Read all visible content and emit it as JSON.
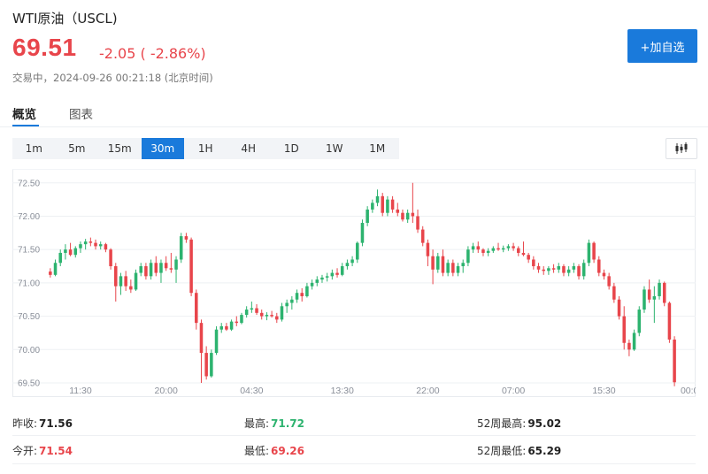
{
  "header": {
    "title": "WTI原油（USCL)",
    "price": "69.51",
    "change": "-2.05 ( -2.86%)",
    "status": "交易中，2024-09-26 00:21:18 (北京时间)",
    "add_watchlist_label": "+加自选"
  },
  "tabs": [
    {
      "label": "概览",
      "active": true
    },
    {
      "label": "图表",
      "active": false
    }
  ],
  "periods": [
    {
      "label": "1m",
      "active": false
    },
    {
      "label": "5m",
      "active": false
    },
    {
      "label": "15m",
      "active": false
    },
    {
      "label": "30m",
      "active": true
    },
    {
      "label": "1H",
      "active": false
    },
    {
      "label": "4H",
      "active": false
    },
    {
      "label": "1D",
      "active": false
    },
    {
      "label": "1W",
      "active": false
    },
    {
      "label": "1M",
      "active": false
    }
  ],
  "chart_type_icon": "candlestick-icon",
  "colors": {
    "up": "#2db36f",
    "down": "#e8454b",
    "accent": "#1a7adb"
  },
  "chart_data": {
    "type": "candlestick",
    "ylim": [
      69.5,
      72.55
    ],
    "y_ticks": [
      "72.50",
      "72.00",
      "71.50",
      "71.00",
      "70.50",
      "70.00",
      "69.50"
    ],
    "y_tick_values": [
      72.5,
      72.0,
      71.5,
      71.0,
      70.5,
      70.0,
      69.5
    ],
    "x_ticks": [
      "11:30",
      "20:00",
      "04:30",
      "13:30",
      "22:00",
      "07:00",
      "15:30",
      "00:0"
    ],
    "x_tick_index": [
      6,
      23,
      40,
      58,
      75,
      92,
      110,
      127
    ],
    "bar_count": 128,
    "grid": true,
    "ohlc": [
      [
        71.17,
        71.22,
        71.08,
        71.12
      ],
      [
        71.12,
        71.35,
        71.1,
        71.3
      ],
      [
        71.3,
        71.5,
        71.25,
        71.45
      ],
      [
        71.45,
        71.58,
        71.35,
        71.5
      ],
      [
        71.5,
        71.6,
        71.4,
        71.42
      ],
      [
        71.42,
        71.55,
        71.38,
        71.52
      ],
      [
        71.52,
        71.62,
        71.45,
        71.58
      ],
      [
        71.58,
        71.66,
        71.5,
        71.62
      ],
      [
        71.62,
        71.68,
        71.55,
        71.6
      ],
      [
        71.6,
        71.65,
        71.5,
        71.55
      ],
      [
        71.55,
        71.62,
        71.5,
        71.58
      ],
      [
        71.58,
        71.6,
        71.46,
        71.5
      ],
      [
        71.5,
        71.52,
        71.2,
        71.25
      ],
      [
        71.25,
        71.3,
        70.72,
        70.95
      ],
      [
        70.95,
        71.15,
        70.82,
        71.1
      ],
      [
        71.1,
        71.18,
        70.88,
        70.95
      ],
      [
        70.95,
        71.05,
        70.85,
        70.9
      ],
      [
        70.9,
        71.2,
        70.88,
        71.15
      ],
      [
        71.15,
        71.3,
        71.1,
        71.25
      ],
      [
        71.25,
        71.3,
        71.05,
        71.1
      ],
      [
        71.1,
        71.35,
        71.05,
        71.3
      ],
      [
        71.3,
        71.4,
        71.1,
        71.15
      ],
      [
        71.15,
        71.35,
        71.0,
        71.3
      ],
      [
        71.3,
        71.4,
        71.18,
        71.22
      ],
      [
        71.22,
        71.45,
        71.15,
        71.2
      ],
      [
        71.2,
        71.4,
        71.0,
        71.35
      ],
      [
        71.35,
        71.75,
        71.3,
        71.7
      ],
      [
        71.7,
        71.75,
        71.6,
        71.65
      ],
      [
        71.65,
        71.68,
        70.8,
        70.85
      ],
      [
        70.85,
        70.9,
        70.3,
        70.4
      ],
      [
        70.4,
        70.45,
        69.5,
        69.95
      ],
      [
        69.95,
        70.05,
        69.55,
        69.6
      ],
      [
        69.6,
        70.0,
        69.58,
        69.95
      ],
      [
        69.95,
        70.35,
        69.92,
        70.3
      ],
      [
        70.3,
        70.4,
        70.25,
        70.35
      ],
      [
        70.35,
        70.4,
        70.28,
        70.3
      ],
      [
        70.3,
        70.45,
        70.28,
        70.42
      ],
      [
        70.42,
        70.5,
        70.35,
        70.4
      ],
      [
        70.4,
        70.55,
        70.38,
        70.52
      ],
      [
        70.52,
        70.65,
        70.48,
        70.6
      ],
      [
        70.6,
        70.72,
        70.55,
        70.62
      ],
      [
        70.62,
        70.68,
        70.52,
        70.55
      ],
      [
        70.55,
        70.6,
        70.45,
        70.5
      ],
      [
        70.5,
        70.56,
        70.44,
        70.52
      ],
      [
        70.52,
        70.58,
        70.48,
        70.5
      ],
      [
        70.5,
        70.55,
        70.4,
        70.45
      ],
      [
        70.45,
        70.7,
        70.42,
        70.65
      ],
      [
        70.65,
        70.75,
        70.55,
        70.7
      ],
      [
        70.7,
        70.8,
        70.6,
        70.75
      ],
      [
        70.75,
        70.9,
        70.7,
        70.85
      ],
      [
        70.85,
        70.92,
        70.72,
        70.8
      ],
      [
        70.8,
        71.0,
        70.78,
        70.95
      ],
      [
        70.95,
        71.05,
        70.9,
        71.0
      ],
      [
        71.0,
        71.1,
        70.95,
        71.05
      ],
      [
        71.05,
        71.12,
        71.0,
        71.08
      ],
      [
        71.08,
        71.15,
        71.02,
        71.1
      ],
      [
        71.1,
        71.2,
        71.05,
        71.15
      ],
      [
        71.15,
        71.22,
        71.08,
        71.12
      ],
      [
        71.12,
        71.3,
        71.1,
        71.25
      ],
      [
        71.25,
        71.35,
        71.2,
        71.3
      ],
      [
        71.3,
        71.4,
        71.25,
        71.35
      ],
      [
        71.35,
        71.62,
        71.3,
        71.6
      ],
      [
        71.6,
        71.95,
        71.55,
        71.9
      ],
      [
        71.9,
        72.15,
        71.85,
        72.1
      ],
      [
        72.1,
        72.25,
        72.05,
        72.2
      ],
      [
        72.2,
        72.4,
        72.15,
        72.3
      ],
      [
        72.3,
        72.35,
        72.0,
        72.05
      ],
      [
        72.05,
        72.3,
        72.0,
        72.25
      ],
      [
        72.25,
        72.3,
        72.05,
        72.1
      ],
      [
        72.1,
        72.2,
        72.0,
        72.05
      ],
      [
        72.05,
        72.1,
        71.92,
        71.95
      ],
      [
        71.95,
        72.1,
        71.9,
        72.05
      ],
      [
        72.05,
        72.5,
        71.9,
        72.0
      ],
      [
        72.0,
        72.1,
        71.75,
        71.8
      ],
      [
        71.8,
        71.85,
        71.55,
        71.6
      ],
      [
        71.6,
        71.65,
        71.25,
        71.4
      ],
      [
        71.4,
        71.5,
        70.98,
        71.2
      ],
      [
        71.2,
        71.45,
        71.15,
        71.4
      ],
      [
        71.4,
        71.5,
        71.1,
        71.15
      ],
      [
        71.15,
        71.35,
        71.1,
        71.3
      ],
      [
        71.3,
        71.35,
        71.1,
        71.15
      ],
      [
        71.15,
        71.3,
        71.1,
        71.25
      ],
      [
        71.25,
        71.35,
        71.15,
        71.3
      ],
      [
        71.3,
        71.55,
        71.25,
        71.5
      ],
      [
        71.5,
        71.6,
        71.45,
        71.55
      ],
      [
        71.55,
        71.62,
        71.45,
        71.5
      ],
      [
        71.5,
        71.52,
        71.4,
        71.45
      ],
      [
        71.45,
        71.52,
        71.4,
        71.48
      ],
      [
        71.48,
        71.55,
        71.45,
        71.52
      ],
      [
        71.52,
        71.6,
        71.48,
        71.5
      ],
      [
        71.5,
        71.56,
        71.46,
        71.52
      ],
      [
        71.52,
        71.58,
        71.48,
        71.55
      ],
      [
        71.55,
        71.6,
        71.48,
        71.52
      ],
      [
        71.52,
        71.55,
        71.4,
        71.45
      ],
      [
        71.45,
        71.62,
        71.4,
        71.42
      ],
      [
        71.42,
        71.45,
        71.3,
        71.35
      ],
      [
        71.35,
        71.4,
        71.2,
        71.25
      ],
      [
        71.25,
        71.3,
        71.15,
        71.2
      ],
      [
        71.2,
        71.25,
        71.12,
        71.18
      ],
      [
        71.18,
        71.25,
        71.12,
        71.22
      ],
      [
        71.22,
        71.28,
        71.15,
        71.2
      ],
      [
        71.2,
        71.3,
        71.15,
        71.25
      ],
      [
        71.25,
        71.28,
        71.1,
        71.15
      ],
      [
        71.15,
        71.25,
        71.1,
        71.2
      ],
      [
        71.2,
        71.3,
        71.15,
        71.25
      ],
      [
        71.25,
        71.28,
        71.05,
        71.1
      ],
      [
        71.1,
        71.35,
        71.05,
        71.3
      ],
      [
        71.3,
        71.65,
        71.25,
        71.6
      ],
      [
        71.6,
        71.62,
        71.3,
        71.35
      ],
      [
        71.35,
        71.4,
        71.1,
        71.15
      ],
      [
        71.15,
        71.2,
        71.05,
        71.1
      ],
      [
        71.1,
        71.15,
        70.9,
        70.95
      ],
      [
        70.95,
        71.0,
        70.7,
        70.75
      ],
      [
        70.75,
        70.8,
        70.45,
        70.5
      ],
      [
        70.5,
        70.65,
        70.0,
        70.1
      ],
      [
        70.1,
        70.15,
        69.9,
        70.0
      ],
      [
        70.0,
        70.3,
        69.98,
        70.25
      ],
      [
        70.25,
        70.65,
        70.2,
        70.6
      ],
      [
        70.6,
        70.95,
        70.55,
        70.9
      ],
      [
        70.9,
        71.05,
        70.7,
        70.75
      ],
      [
        70.75,
        70.95,
        70.4,
        70.8
      ],
      [
        70.8,
        71.05,
        70.75,
        71.0
      ],
      [
        71.0,
        71.02,
        70.65,
        70.7
      ],
      [
        70.7,
        70.72,
        70.1,
        70.15
      ],
      [
        70.15,
        70.2,
        69.45,
        69.51
      ]
    ]
  },
  "stats": [
    {
      "label": "昨收:",
      "value": "71.56",
      "tone": "plain"
    },
    {
      "label": "最高:",
      "value": "71.72",
      "tone": "up"
    },
    {
      "label": "52周最高:",
      "value": "95.02",
      "tone": "plain"
    },
    {
      "label": "今开:",
      "value": "71.54",
      "tone": "down"
    },
    {
      "label": "最低:",
      "value": "69.26",
      "tone": "down"
    },
    {
      "label": "52周最低:",
      "value": "65.29",
      "tone": "plain"
    }
  ]
}
